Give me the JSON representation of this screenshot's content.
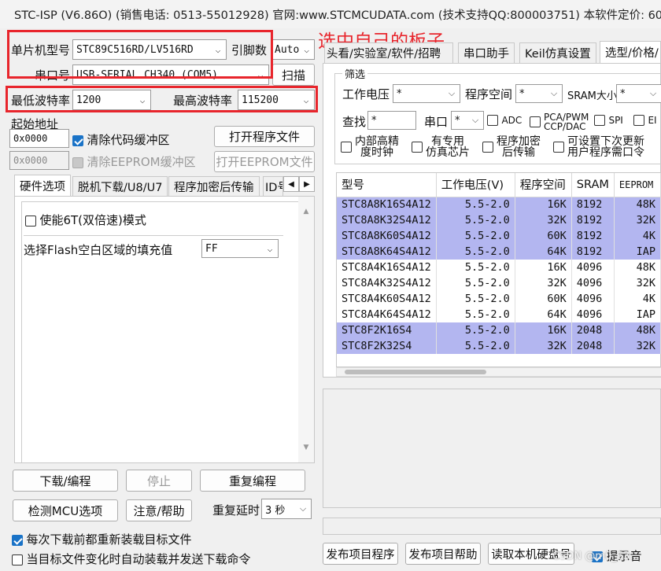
{
  "window": {
    "title": "STC-ISP (V6.86O) (销售电话: 0513-55012928) 官网:www.STCMCUDATA.com (技术支持QQ:800003751) 本软件定价: 60..."
  },
  "annotation": {
    "text": "选中自己的板子"
  },
  "left": {
    "mcu_label": "单片机型号",
    "mcu_value": "STC89C516RD/LV516RD",
    "pin_label": "引脚数",
    "pin_value": "Auto",
    "port_label": "串口号",
    "port_value": "USB-SERIAL CH340 (COM5)",
    "scan_button": "扫描",
    "min_baud_label": "最低波特率",
    "min_baud_value": "1200",
    "max_baud_label": "最高波特率",
    "max_baud_value": "115200",
    "start_addr_label": "起始地址",
    "start_addr_1": "0x0000",
    "clear_code_label": "清除代码缓冲区",
    "open_program_button": "打开程序文件",
    "start_addr_2": "0x0000",
    "clear_eeprom_label": "清除EEPROM缓冲区",
    "open_eeprom_button": "打开EEPROM文件",
    "tabs": [
      "硬件选项",
      "脱机下载/U8/U7",
      "程序加密后传输",
      "ID号"
    ],
    "enable_6t_label": "使能6T(双倍速)模式",
    "fill_label": "选择Flash空白区域的填充值",
    "fill_value": "FF",
    "download_button": "下载/编程",
    "stop_button": "停止",
    "reprogram_button": "重复编程",
    "detect_button": "检测MCU选项",
    "help_button": "注意/帮助",
    "delay_label": "重复延时",
    "delay_value": "3 秒",
    "reload_label": "每次下载前都重新装载目标文件",
    "auto_load_label": "当目标文件变化时自动装载并发送下载命令"
  },
  "right": {
    "tabs": [
      "头看/实验室/软件/招聘",
      "串口助手",
      "Keil仿真设置",
      "选型/价格/"
    ],
    "filter_title": "筛选",
    "voltage_label": "工作电压",
    "voltage_value": "*",
    "space_label": "程序空间",
    "space_value": "*",
    "sram_label": "SRAM大小",
    "sram_value": "*",
    "find_label": "查找",
    "find_value": "*",
    "serial_label": "串口",
    "serial_value": "*",
    "adc_label": "ADC",
    "pca_label_1": "PCA/PWM",
    "pca_label_2": "CCP/DAC",
    "spi_label": "SPI",
    "ei_label": "EI",
    "internal_osc_1": "内部高精",
    "internal_osc_2": "度时钟",
    "dedicated_1": "有专用",
    "dedicated_2": "仿真芯片",
    "encrypt_1": "程序加密",
    "encrypt_2": "后传输",
    "update_1": "可设置下次更新",
    "update_2": "用户程序需口令",
    "table": {
      "headers": [
        "型号",
        "工作电压(V)",
        "程序空间",
        "SRAM",
        "EEPROM"
      ],
      "rows": [
        {
          "model": "STC8A8K16S4A12",
          "voltage": "5.5-2.0",
          "space": "16K",
          "sram": "8192",
          "eeprom": "48K",
          "hl": true
        },
        {
          "model": "STC8A8K32S4A12",
          "voltage": "5.5-2.0",
          "space": "32K",
          "sram": "8192",
          "eeprom": "32K",
          "hl": true
        },
        {
          "model": "STC8A8K60S4A12",
          "voltage": "5.5-2.0",
          "space": "60K",
          "sram": "8192",
          "eeprom": "4K",
          "hl": true
        },
        {
          "model": "STC8A8K64S4A12",
          "voltage": "5.5-2.0",
          "space": "64K",
          "sram": "8192",
          "eeprom": "IAP",
          "hl": true
        },
        {
          "model": "STC8A4K16S4A12",
          "voltage": "5.5-2.0",
          "space": "16K",
          "sram": "4096",
          "eeprom": "48K",
          "hl": false
        },
        {
          "model": "STC8A4K32S4A12",
          "voltage": "5.5-2.0",
          "space": "32K",
          "sram": "4096",
          "eeprom": "32K",
          "hl": false
        },
        {
          "model": "STC8A4K60S4A12",
          "voltage": "5.5-2.0",
          "space": "60K",
          "sram": "4096",
          "eeprom": "4K",
          "hl": false
        },
        {
          "model": "STC8A4K64S4A12",
          "voltage": "5.5-2.0",
          "space": "64K",
          "sram": "4096",
          "eeprom": "IAP",
          "hl": false
        },
        {
          "model": "STC8F2K16S4",
          "voltage": "5.5-2.0",
          "space": "16K",
          "sram": "2048",
          "eeprom": "48K",
          "hl": true
        },
        {
          "model": "STC8F2K32S4",
          "voltage": "5.5-2.0",
          "space": "32K",
          "sram": "2048",
          "eeprom": "32K",
          "hl": true
        }
      ]
    },
    "publish_button": "发布项目程序",
    "publish_help_button": "发布项目帮助",
    "read_disk_button": "读取本机硬盘号",
    "hint_label": "提示音",
    "watermark": "CSDN @m0_63..."
  }
}
